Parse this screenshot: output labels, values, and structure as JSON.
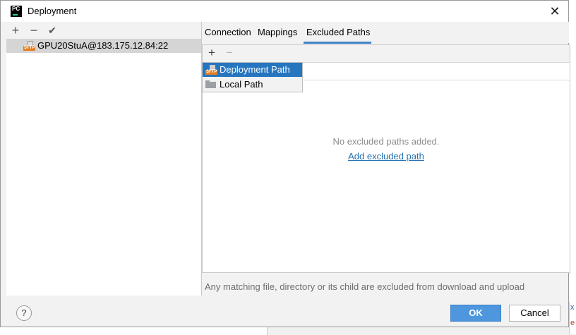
{
  "window": {
    "title": "Deployment",
    "app_icon_text": "PC",
    "close_glyph": "✕"
  },
  "left_toolbar": {
    "add_glyph": "+",
    "remove_glyph": "−",
    "apply_glyph": "✔"
  },
  "servers": [
    {
      "label": "GPU20StuA@183.175.12.84:22",
      "icon": "sftp-icon",
      "icon_text": "SFTP",
      "selected": true
    }
  ],
  "tabs": [
    {
      "label": "Connection",
      "active": false
    },
    {
      "label": "Mappings",
      "active": false
    },
    {
      "label": "Excluded Paths",
      "active": true
    }
  ],
  "content_toolbar": {
    "add_glyph": "+",
    "remove_glyph": "−"
  },
  "popup_menu": {
    "items": [
      {
        "label": "Deployment Path",
        "icon": "sftp-icon",
        "selected": true
      },
      {
        "label": "Local Path",
        "icon": "folder-icon",
        "selected": false
      }
    ]
  },
  "empty_state": {
    "message": "No excluded paths added.",
    "link": "Add excluded path"
  },
  "hint": "Any matching file, directory or its child are excluded from download and upload",
  "footer": {
    "help_glyph": "?",
    "ok_label": "OK",
    "cancel_label": "Cancel"
  },
  "background_fragments": {
    "char1": "x",
    "char2": "e"
  },
  "colors": {
    "accent": "#2675bf",
    "ok_button": "#4e96de",
    "link": "#2470b3",
    "selection_row": "#d5d5d5"
  }
}
